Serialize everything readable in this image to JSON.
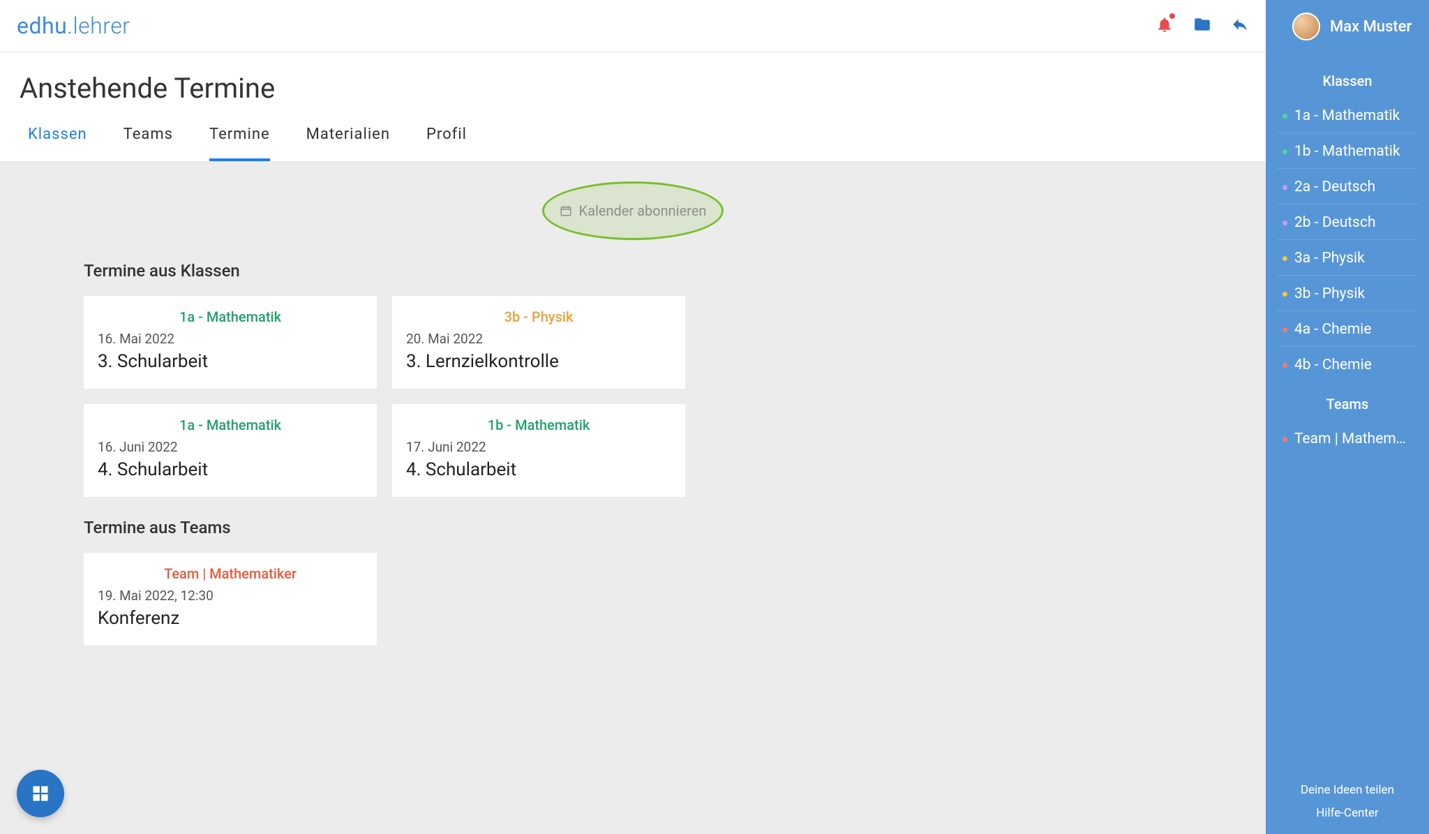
{
  "brand": {
    "a": "edhu",
    "b": "lehrer"
  },
  "page_title": "Anstehende Termine",
  "tabs": [
    {
      "label": "Klassen",
      "id": "klassen"
    },
    {
      "label": "Teams",
      "id": "teams"
    },
    {
      "label": "Termine",
      "id": "termine"
    },
    {
      "label": "Materialien",
      "id": "materialien"
    },
    {
      "label": "Profil",
      "id": "profil"
    }
  ],
  "tab_highlight": "klassen",
  "tab_underline": "termine",
  "subscribe_label": "Kalender abonnieren",
  "sections": {
    "klassen": {
      "heading": "Termine aus Klassen",
      "cards": [
        {
          "klass": "1a - Mathematik",
          "klass_color": "green",
          "date": "16. Mai  2022",
          "title": "3. Schularbeit"
        },
        {
          "klass": "3b - Physik",
          "klass_color": "orange",
          "date": "20. Mai  2022",
          "title": "3. Lernzielkontrolle"
        },
        {
          "klass": "1a - Mathematik",
          "klass_color": "green",
          "date": "16. Juni 2022",
          "title": "4. Schularbeit"
        },
        {
          "klass": "1b - Mathematik",
          "klass_color": "green",
          "date": "17. Juni 2022",
          "title": "4. Schularbeit"
        }
      ]
    },
    "teams": {
      "heading": "Termine aus Teams",
      "cards": [
        {
          "klass": "Team | Mathematiker",
          "klass_color": "red",
          "date": "19. Mai 2022, 12:30",
          "title": "Konferenz"
        }
      ]
    }
  },
  "sidebar": {
    "user": "Max Muster",
    "klassen_heading": "Klassen",
    "klassen": [
      {
        "label": "1a - Mathematik",
        "color": "#4cd4a0"
      },
      {
        "label": "1b - Mathematik",
        "color": "#4cd4a0"
      },
      {
        "label": "2a - Deutsch",
        "color": "#c89bf0"
      },
      {
        "label": "2b - Deutsch",
        "color": "#c89bf0"
      },
      {
        "label": "3a - Physik",
        "color": "#f5c542"
      },
      {
        "label": "3b - Physik",
        "color": "#f5c542"
      },
      {
        "label": "4a - Chemie",
        "color": "#f07b6f"
      },
      {
        "label": "4b - Chemie",
        "color": "#f07b6f"
      }
    ],
    "teams_heading": "Teams",
    "teams": [
      {
        "label": "Team | Mathem…",
        "color": "#f07b6f"
      }
    ],
    "footer": {
      "ideen": "Deine Ideen teilen",
      "hilfe": "Hilfe-Center"
    }
  }
}
